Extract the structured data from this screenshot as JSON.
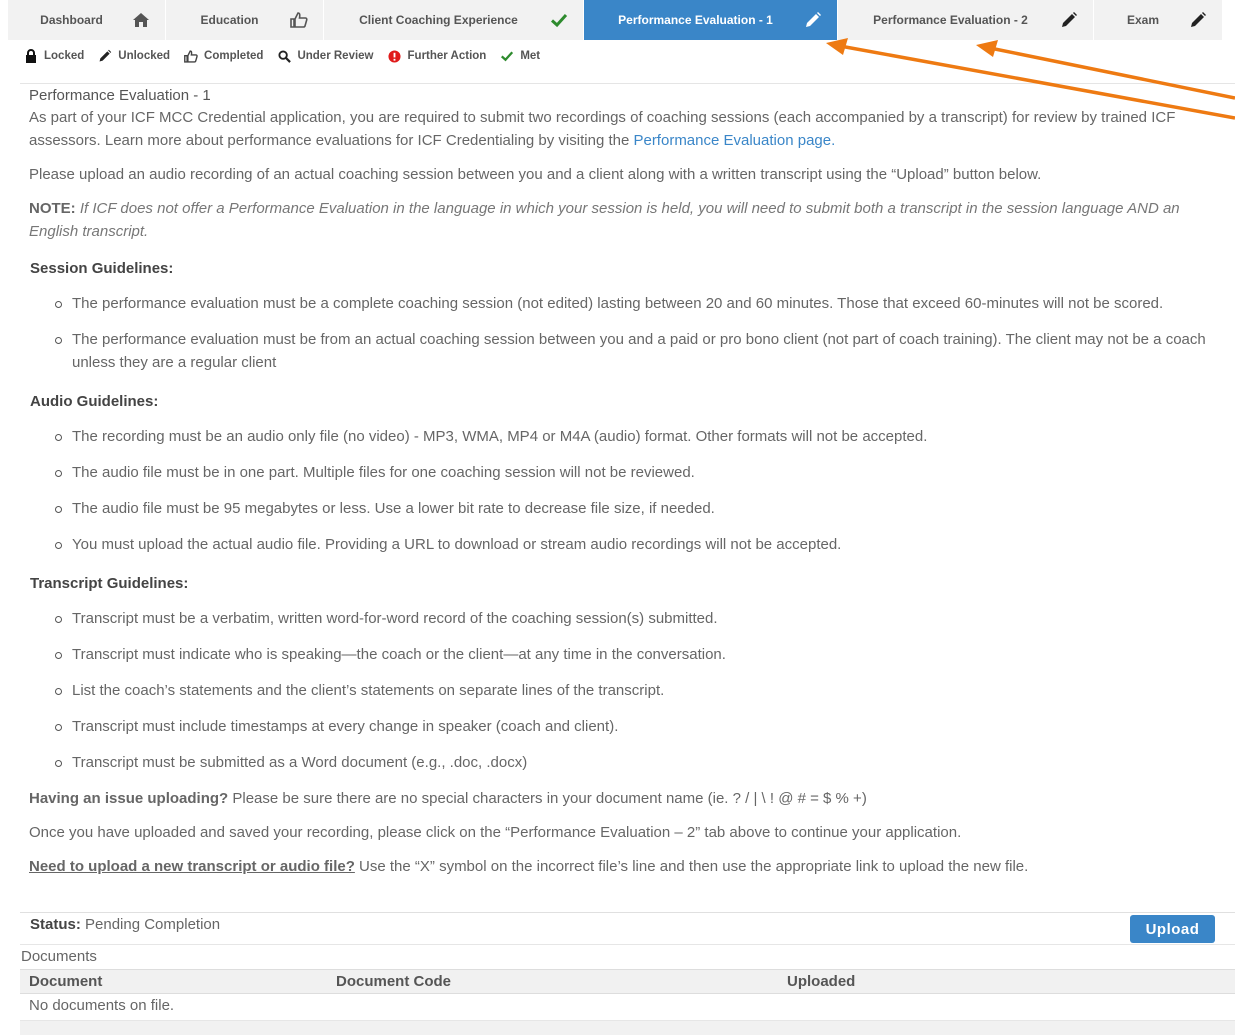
{
  "tabs": [
    {
      "label": "Dashboard",
      "icon": "home-icon",
      "active": false
    },
    {
      "label": "Education",
      "icon": "thumbs-up-icon",
      "active": false
    },
    {
      "label": "Client Coaching Experience",
      "icon": "check-icon",
      "active": false
    },
    {
      "label": "Performance Evaluation - 1",
      "icon": "pencil-icon",
      "active": true
    },
    {
      "label": "Performance Evaluation - 2",
      "icon": "pencil-icon",
      "active": false
    },
    {
      "label": "Exam",
      "icon": "pencil-icon",
      "active": false
    }
  ],
  "legend": [
    {
      "label": "Locked",
      "icon": "lock-icon"
    },
    {
      "label": "Unlocked",
      "icon": "pencil-icon"
    },
    {
      "label": "Completed",
      "icon": "thumbs-up-icon"
    },
    {
      "label": "Under Review",
      "icon": "search-icon"
    },
    {
      "label": "Further Action",
      "icon": "alert-icon"
    },
    {
      "label": "Met",
      "icon": "check-icon"
    }
  ],
  "colors": {
    "accent": "#3a86c8",
    "check": "#2e8b2e",
    "alert": "#e01b1b",
    "arrow": "#ee7a12"
  },
  "content": {
    "title": "Performance Evaluation - 1",
    "intro_text": "As part of your ICF MCC Credential application, you are required to submit two recordings of coaching sessions (each accompanied by a transcript) for review by trained ICF assessors. Learn more about performance evaluations for ICF Credentialing by visiting the ",
    "intro_link": "Performance Evaluation page.",
    "upload_instruction": "Please upload an audio recording of an actual coaching session between you and a client along with a written transcript using the “Upload” button below.",
    "note_label": "NOTE:",
    "note_text": " If ICF does not offer a Performance Evaluation in the language in which your session is held, you will need to submit both a transcript in the session language AND an English transcript.",
    "session_heading": "Session Guidelines:",
    "session_items": [
      "The performance evaluation must be a complete coaching session (not edited) lasting between 20 and 60 minutes. Those that exceed 60-minutes will not be scored.",
      "The performance evaluation must be from an actual coaching session between you and a paid or pro bono client (not part of coach training). The client may not be a coach unless they are a regular client"
    ],
    "audio_heading": "Audio Guidelines:",
    "audio_items": [
      "The recording must be an audio only file (no video) - MP3, WMA, MP4 or M4A (audio) format. Other formats will not be accepted.",
      "The audio file must be in one part. Multiple files for one coaching session will not be reviewed.",
      "The audio file must be 95 megabytes or less. Use a lower bit rate to decrease file size, if needed.",
      "You must upload the actual audio file. Providing a URL to download or stream audio recordings will not be accepted."
    ],
    "transcript_heading": "Transcript Guidelines:",
    "transcript_items": [
      "Transcript must be a verbatim, written word-for-word record of the coaching session(s) submitted.",
      "Transcript must indicate who is speaking—the coach or the client—at any time in the conversation.",
      "List the coach’s statements and the client’s statements on separate lines of the transcript.",
      "Transcript must include timestamps at every change in speaker (coach and client).",
      "Transcript must be submitted as a Word document (e.g., .doc, .docx)"
    ],
    "issue_label": "Having an issue uploading?",
    "issue_text": " Please be sure there are no special characters in your document name (ie. ? / | \\ ! @ # = $ % +)",
    "once_text": "Once you have uploaded and saved your recording, please click on the “Performance Evaluation – 2” tab above to continue your application.",
    "new_label": "Need to upload a new transcript or audio file?",
    "new_text": "  Use the “X” symbol on the incorrect file’s line and then use the appropriate link to upload the new file."
  },
  "status": {
    "label": "Status:",
    "value": " Pending Completion"
  },
  "upload_label": "Upload",
  "documents": {
    "title": "Documents",
    "columns": [
      "Document",
      "Document Code",
      "Uploaded"
    ],
    "empty": "No documents on file."
  }
}
